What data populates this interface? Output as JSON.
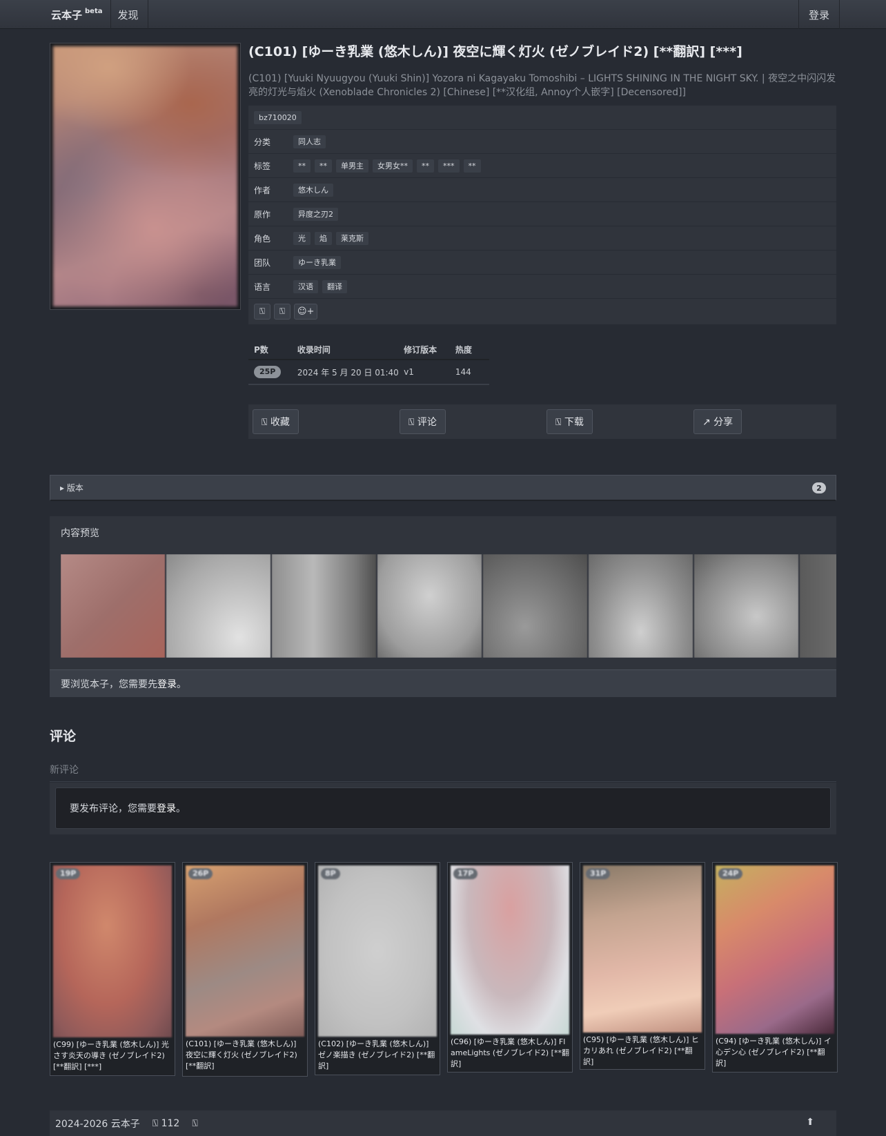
{
  "nav": {
    "brand": "云本子",
    "brand_sup": "beta",
    "discover": "发现",
    "login": "登录"
  },
  "gallery": {
    "title": "(C101) [ゆーき乳業 (悠木しん)] 夜空に輝く灯火 (ゼノブレイド2) [**翻訳] [***]",
    "subtitle": "(C101) [Yuuki Nyuugyou (Yuuki Shin)] Yozora ni Kagayaku Tomoshibi – LIGHTS SHINING IN THE NIGHT SKY. | 夜空之中闪闪发亮的灯光与焰火 (Xenoblade Chronicles 2) [Chinese] [**汉化组, Annoy个人嵌字] [Decensored]]",
    "id_tag": "bz710020",
    "rows": [
      {
        "label": "分类",
        "tags": [
          "同人志"
        ]
      },
      {
        "label": "标签",
        "tags": [
          "**",
          "**",
          "单男主",
          "女男女**",
          "**",
          "***",
          "**"
        ]
      },
      {
        "label": "作者",
        "tags": [
          "悠木しん"
        ]
      },
      {
        "label": "原作",
        "tags": [
          "异度之刃2"
        ]
      },
      {
        "label": "角色",
        "tags": [
          "光",
          "焰",
          "莱克斯"
        ]
      },
      {
        "label": "团队",
        "tags": [
          "ゆーき乳業"
        ]
      },
      {
        "label": "语言",
        "tags": [
          "汉语",
          "翻译"
        ]
      }
    ],
    "icon_buttons": [
      "⍂",
      "⍂",
      "☺+"
    ]
  },
  "stats": {
    "headers": [
      "P数",
      "收录时间",
      "修订版本",
      "热度"
    ],
    "pages": "25P",
    "added": "2024 年 5 月 20 日 01:40",
    "revision": "v1",
    "heat": "144"
  },
  "actions": {
    "favorite": "⍂ 收藏",
    "comment": "⍂ 评论",
    "download": "⍂ 下载",
    "share": "↗ 分享"
  },
  "versions": {
    "label": "▸ 版本",
    "count": "2"
  },
  "preview": {
    "title": "内容预览",
    "login_prefix": "要浏览本子，您需要先 ",
    "login_link": "登录",
    "login_suffix": "。"
  },
  "comments": {
    "title": "评论",
    "new_comment": "新评论",
    "login_prefix": "要发布评论，您需要 ",
    "login_link": "登录",
    "login_suffix": "。"
  },
  "related": [
    {
      "pages": "19P",
      "title": "(C99) [ゆーき乳業 (悠木しん)] 光さす炎天の導き (ゼノブレイド2) [**翻訳] [***]"
    },
    {
      "pages": "26P",
      "title": "(C101) [ゆーき乳業 (悠木しん)] 夜空に輝く灯火 (ゼノブレイド2) [**翻訳]"
    },
    {
      "pages": "8P",
      "title": "(C102) [ゆーき乳業 (悠木しん)] ゼノ楽描き (ゼノブレイド2) [**翻訳]"
    },
    {
      "pages": "17P",
      "title": "(C96) [ゆーき乳業 (悠木しん)] FlameLights (ゼノブレイド2) [**翻訳]"
    },
    {
      "pages": "31P",
      "title": "(C95) [ゆーき乳業 (悠木しん)] ヒカリあれ (ゼノブレイド2) [**翻訳]"
    },
    {
      "pages": "24P",
      "title": "(C94) [ゆーき乳業 (悠木しん)] イ心デン心 (ゼノブレイド2) [**翻訳]"
    }
  ],
  "footer": {
    "copyright": "2024-2026 云本子",
    "count": "⍂ 112",
    "icon": "⍂",
    "up": "⬆"
  }
}
